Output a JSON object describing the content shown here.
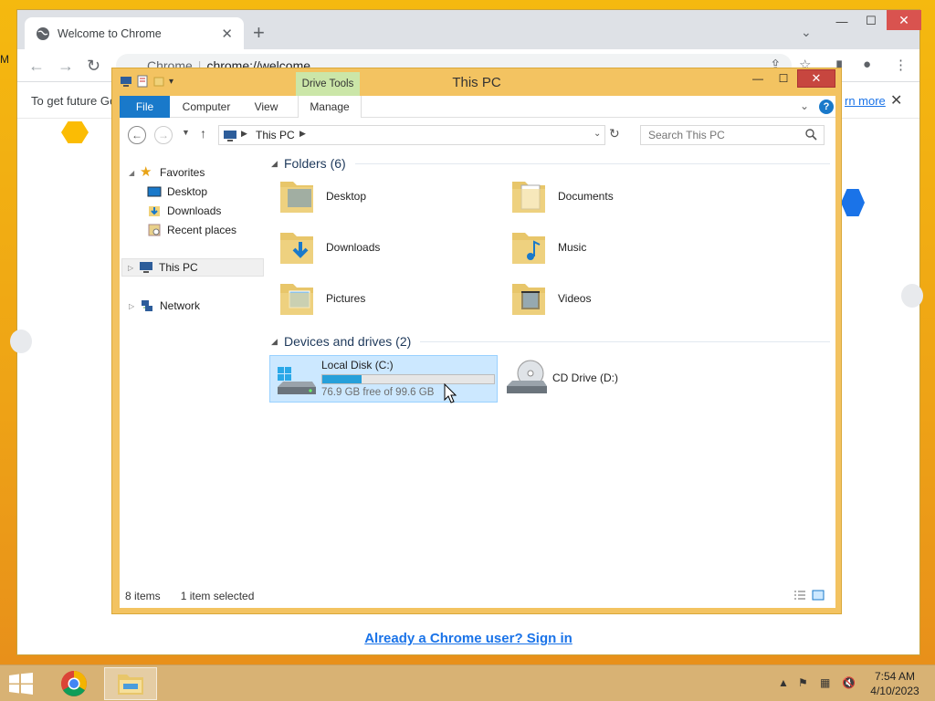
{
  "desktop": {
    "edge_label": "M"
  },
  "chrome": {
    "tab_title": "Welcome to Chrome",
    "omnibox_label": "Chrome",
    "url": "chrome://welcome",
    "infobar_message": "To get future Ge",
    "infobar_link": "rn more",
    "signin_link": "Already a Chrome user? Sign in"
  },
  "explorer": {
    "title": "This PC",
    "contextual_tab": "Drive Tools",
    "ribbon_tabs": [
      "File",
      "Computer",
      "View",
      "Manage"
    ],
    "breadcrumb": "This PC",
    "search_placeholder": "Search This PC",
    "nav": {
      "favorites": "Favorites",
      "desktop": "Desktop",
      "downloads": "Downloads",
      "recent": "Recent places",
      "thispc": "This PC",
      "network": "Network"
    },
    "folders_header": "Folders (6)",
    "folders": [
      "Desktop",
      "Documents",
      "Downloads",
      "Music",
      "Pictures",
      "Videos"
    ],
    "devices_header": "Devices and drives (2)",
    "drives": [
      {
        "name": "Local Disk (C:)",
        "free": "76.9 GB free of 99.6 GB",
        "used_fraction": 0.228
      },
      {
        "name": "CD Drive (D:)"
      }
    ],
    "status_items": "8 items",
    "status_selected": "1 item selected"
  },
  "taskbar": {
    "time": "7:54 AM",
    "date": "4/10/2023"
  },
  "colors": {
    "accent": "#1979ca",
    "selection": "#cce8ff",
    "drive_fill": "#26a0da",
    "desktop": "#f5b90f"
  }
}
